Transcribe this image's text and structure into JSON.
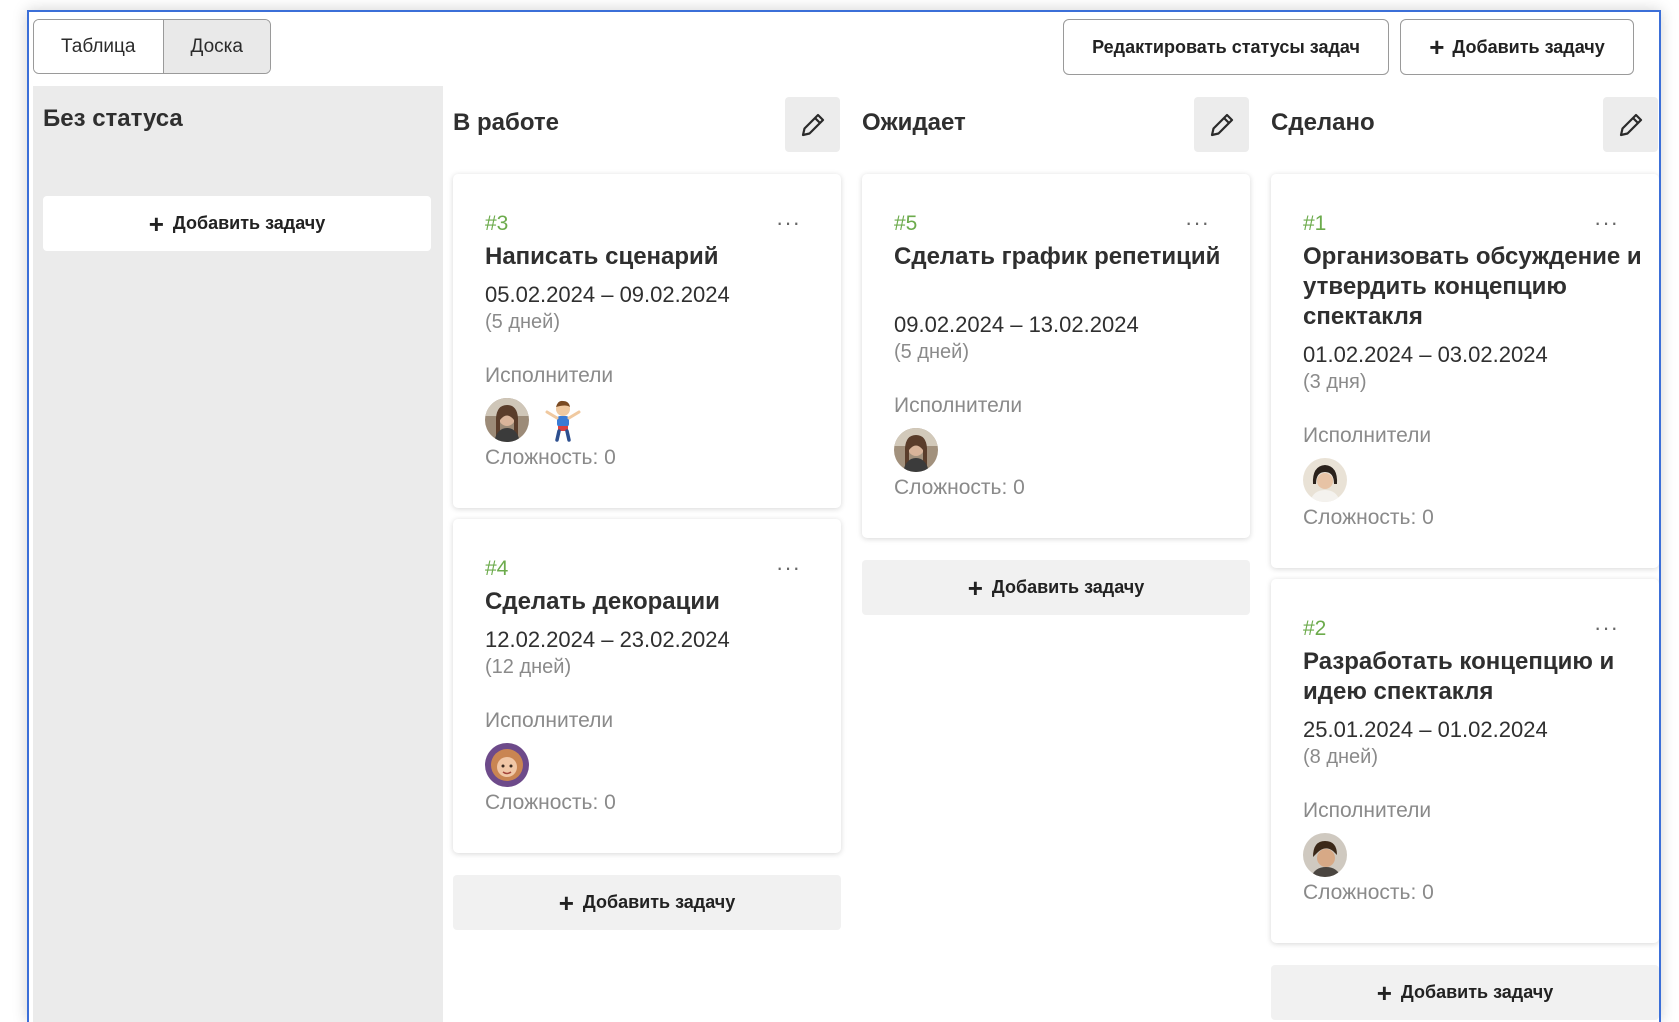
{
  "view_toggle": {
    "table": "Таблица",
    "board": "Доска"
  },
  "top_buttons": {
    "edit_statuses": "Редактировать статусы задач",
    "add_task": "Добавить задачу",
    "plus": "+"
  },
  "columns": [
    {
      "title": "Без статуса",
      "add_task": "Добавить задачу"
    },
    {
      "title": "В работе",
      "add_task": "Добавить задачу"
    },
    {
      "title": "Ожидает",
      "add_task": "Добавить задачу"
    },
    {
      "title": "Сделано",
      "add_task": "Добавить задачу"
    }
  ],
  "cards": [
    {
      "num": "#3",
      "title": "Написать сценарий",
      "dates": "05.02.2024 – 09.02.2024",
      "duration": "(5 дней)",
      "exec_label": "Исполнители",
      "complexity": "Сложность: 0",
      "dots": "···"
    },
    {
      "num": "#4",
      "title": "Сделать декорации",
      "dates": "12.02.2024 – 23.02.2024",
      "duration": "(12 дней)",
      "exec_label": "Исполнители",
      "complexity": "Сложность: 0",
      "dots": "···"
    },
    {
      "num": "#5",
      "title": "Сделать график репетиций",
      "dates": "09.02.2024 – 13.02.2024",
      "duration": "(5 дней)",
      "exec_label": "Исполнители",
      "complexity": "Сложность: 0",
      "dots": "···"
    },
    {
      "num": "#1",
      "title": "Организовать обсуждение и утвердить концепцию спектакля",
      "dates": "01.02.2024 – 03.02.2024",
      "duration": "(3 дня)",
      "exec_label": "Исполнители",
      "complexity": "Сложность: 0",
      "dots": "···"
    },
    {
      "num": "#2",
      "title": "Разработать концепцию и идею спектакля",
      "dates": "25.01.2024 – 01.02.2024",
      "duration": "(8 дней)",
      "exec_label": "Исполнители",
      "complexity": "Сложность: 0",
      "dots": "···"
    }
  ],
  "colors": {
    "accent_number": "#6cab4c",
    "frame_border": "#3b6fd8",
    "no_status_bg": "#ebebeb"
  }
}
